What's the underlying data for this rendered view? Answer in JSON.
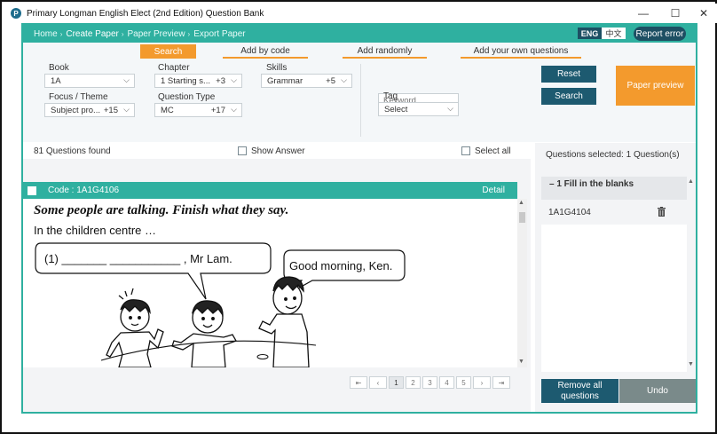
{
  "window": {
    "title": "Primary Longman English Elect (2nd Edition) Question Bank",
    "minimize": "—",
    "maximize": "☐",
    "close": "✕"
  },
  "nav": {
    "breadcrumbs": [
      "Home",
      "Create Paper",
      "Paper Preview",
      "Export Paper"
    ],
    "lang_eng": "ENG",
    "lang_zh": "中文",
    "report_error": "Report error"
  },
  "tabs": [
    "Search",
    "Add by code",
    "Add randomly",
    "Add your own questions"
  ],
  "filters": {
    "book": {
      "label": "Book",
      "value": "1A"
    },
    "chapter": {
      "label": "Chapter",
      "value": "1 Starting s...",
      "count": "+3"
    },
    "skills": {
      "label": "Skills",
      "value": "Grammar",
      "count": "+5"
    },
    "focus": {
      "label": "Focus / Theme",
      "value": "Subject pro...",
      "count": "+15"
    },
    "question_type": {
      "label": "Question Type",
      "value": "MC",
      "count": "+17"
    },
    "keyword_placeholder": "Keyword",
    "tag": {
      "label": "Tag",
      "value": "Select"
    }
  },
  "buttons": {
    "reset": "Reset",
    "search": "Search",
    "paper_preview": "Paper preview",
    "remove_all": "Remove all questions",
    "undo": "Undo"
  },
  "results": {
    "count_text": "81 Questions found",
    "show_answer": "Show Answer",
    "select_all": "Select all"
  },
  "question": {
    "code": "Code : 1A1G4106",
    "detail": "Detail",
    "instruction": "Some people are talking. Finish what they say.",
    "setting": "In the children centre …",
    "bubble1": "(1) _______ ___________ , Mr Lam.",
    "bubble2": "Good morning, Ken."
  },
  "pager": {
    "first": "⇤",
    "prev": "‹",
    "pages": [
      "1",
      "2",
      "3",
      "4",
      "5"
    ],
    "next": "›",
    "last": "⇥"
  },
  "selected": {
    "summary": "Questions selected: 1 Question(s)",
    "group": "– 1 Fill in the blanks",
    "items": [
      "1A1G4104"
    ]
  },
  "colors": {
    "teal": "#2fb0a0",
    "navy": "#1d5a70",
    "orange": "#f39a2d"
  }
}
